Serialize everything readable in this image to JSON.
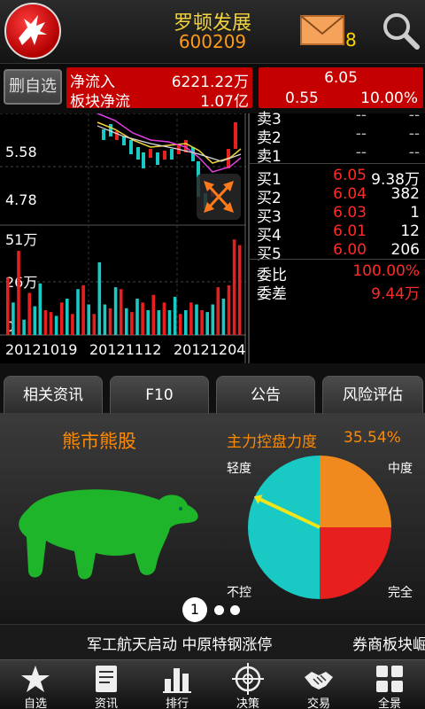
{
  "header": {
    "stock_name": "罗顿发展",
    "stock_code": "600209",
    "mail_count": "8"
  },
  "toolbar": {
    "delete_favorite": "删自选"
  },
  "flow": {
    "net_inflow_label": "净流入",
    "net_inflow_value": "6221.22万",
    "sector_flow_label": "板块净流",
    "sector_flow_value": "1.07亿"
  },
  "quote": {
    "price": "6.05",
    "change": "0.55",
    "change_pct": "10.00%"
  },
  "chart_data": {
    "type": "bar",
    "price_axis_labels": [
      "5.58",
      "4.78"
    ],
    "volume_axis_labels": [
      "51万",
      "26万",
      "0"
    ],
    "date_labels": [
      "20121019",
      "20121112",
      "20121204"
    ],
    "volume_ylim": [
      0,
      51
    ],
    "volumes": [
      30,
      17,
      44,
      8,
      22,
      15,
      27,
      13,
      12,
      10,
      17,
      19,
      11,
      24,
      26,
      16,
      11,
      38,
      16,
      14,
      25,
      24,
      14,
      12,
      19,
      17,
      13,
      21,
      13,
      17,
      13,
      20,
      11,
      13,
      17,
      16,
      13,
      12,
      16,
      25,
      19,
      26,
      50,
      47
    ],
    "volume_up": [
      1,
      0,
      1,
      0,
      1,
      0,
      0,
      1,
      1,
      0,
      1,
      0,
      1,
      0,
      1,
      0,
      1,
      0,
      0,
      1,
      0,
      1,
      0,
      1,
      0,
      1,
      0,
      1,
      0,
      1,
      0,
      0,
      1,
      0,
      1,
      0,
      1,
      0,
      0,
      1,
      0,
      1,
      1,
      1
    ]
  },
  "order_book": {
    "rows": [
      {
        "label": "卖3",
        "price": "--",
        "qty": "--"
      },
      {
        "label": "卖2",
        "price": "--",
        "qty": "--"
      },
      {
        "label": "卖1",
        "price": "--",
        "qty": "--"
      },
      {
        "label": "买1",
        "price": "6.05",
        "qty": "9.38万"
      },
      {
        "label": "买2",
        "price": "6.04",
        "qty": "382"
      },
      {
        "label": "买3",
        "price": "6.03",
        "qty": "1"
      },
      {
        "label": "买4",
        "price": "6.01",
        "qty": "12"
      },
      {
        "label": "买5",
        "price": "6.00",
        "qty": "206"
      }
    ],
    "commission_ratio_label": "委比",
    "commission_ratio_value": "100.00%",
    "commission_diff_label": "委差",
    "commission_diff_value": "9.44万",
    "colors": {
      "price": "#ff2a2a",
      "na": "#bbbbbb"
    }
  },
  "tabs": [
    "相关资讯",
    "F10",
    "公告",
    "风险评估"
  ],
  "risk": {
    "bear_title": "熊市熊股",
    "control_title": "主力控盘力度",
    "control_value": "35.54%",
    "control_pct": 35.54,
    "pie_labels": {
      "light": "轻度",
      "medium": "中度",
      "none": "不控",
      "full": "完全"
    },
    "page_indicator": "1",
    "colors": {
      "light": "#19c9c4",
      "medium": "#f08a1e",
      "full": "#e81f1f",
      "bear": "#1fb52a"
    }
  },
  "ticker": {
    "text": "军工航天启动 中原特钢涨停",
    "text2": "券商板块崛"
  },
  "nav": [
    "自选",
    "资讯",
    "排行",
    "决策",
    "交易",
    "全景"
  ]
}
